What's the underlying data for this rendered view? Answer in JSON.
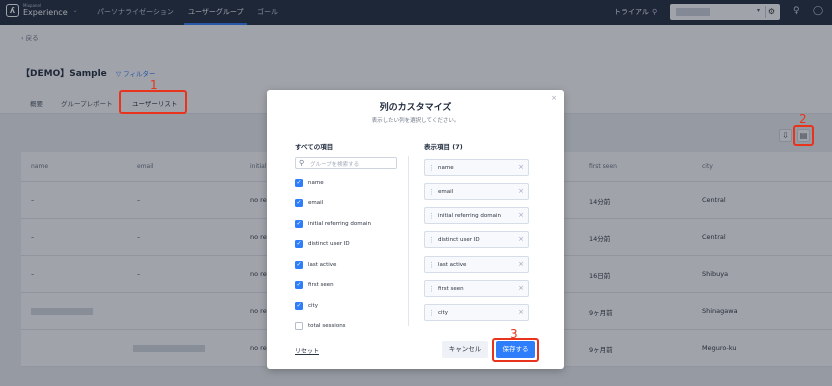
{
  "brand": {
    "small": "Mixpanel",
    "name": "Experience"
  },
  "nav": {
    "tabs": [
      "パーソナライゼーション",
      "ユーザーグループ",
      "ゴール"
    ],
    "active_tab": "ユーザーグループ",
    "trial_label": "トライアル"
  },
  "page": {
    "back_label": "戻る",
    "title": "【DEMO】Sample",
    "filter_label": "フィルター",
    "subtabs": [
      "概要",
      "グループレポート",
      "ユーザーリスト"
    ],
    "active_subtab": "ユーザーリスト"
  },
  "table": {
    "columns": [
      "name",
      "email",
      "initial r",
      "first seen",
      "city"
    ],
    "rows": [
      {
        "name": "–",
        "email": "–",
        "referring": "no ref",
        "first_seen": "14分前",
        "city": "Central"
      },
      {
        "name": "–",
        "email": "–",
        "referring": "no ref",
        "first_seen": "14分前",
        "city": "Central"
      },
      {
        "name": "–",
        "email": "–",
        "referring": "no ref",
        "first_seen": "16日前",
        "city": "Shibuya"
      },
      {
        "name": "",
        "email": "",
        "referring": "no ref",
        "first_seen": "9ヶ月前",
        "city": "Shinagawa"
      },
      {
        "name": "",
        "email": "",
        "referring": "no ref",
        "first_seen": "9ヶ月前",
        "city": "Meguro-ku"
      }
    ]
  },
  "modal": {
    "title": "列のカスタマイズ",
    "subtitle": "表示したい列を選択してください。",
    "all_items_heading": "すべての項目",
    "search_placeholder": "グループを検索する",
    "all_items": [
      {
        "label": "name",
        "checked": true
      },
      {
        "label": "email",
        "checked": true
      },
      {
        "label": "initial referring domain",
        "checked": true
      },
      {
        "label": "distinct user ID",
        "checked": true
      },
      {
        "label": "last active",
        "checked": true
      },
      {
        "label": "first seen",
        "checked": true
      },
      {
        "label": "city",
        "checked": true
      },
      {
        "label": "total sessions",
        "checked": false
      }
    ],
    "selected_heading": "表示項目 (7)",
    "selected_items": [
      "name",
      "email",
      "initial referring domain",
      "distinct user ID",
      "last active",
      "first seen",
      "city"
    ],
    "reset_label": "リセット",
    "cancel_label": "キャンセル",
    "save_label": "保存する"
  },
  "annotations": [
    "1",
    "2",
    "3"
  ],
  "colors": {
    "nav_bg": "#1f2a3c",
    "accent": "#2e7dfa",
    "annotation": "#e8341c"
  }
}
